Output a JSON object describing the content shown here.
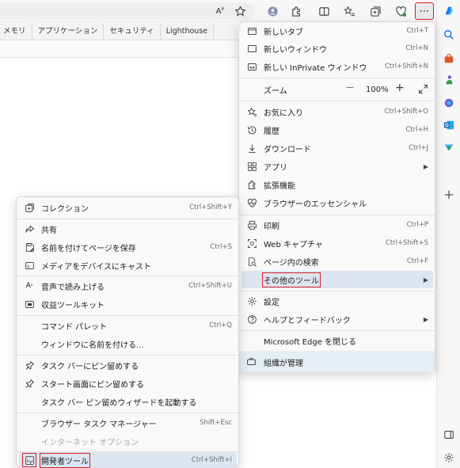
{
  "toolbar": {
    "read_aloud_glyph": "Aᴾ",
    "more_label": "⋯"
  },
  "devtools_tabs": [
    "メモリ",
    "アプリケーション",
    "セキュリティ",
    "Lighthouse"
  ],
  "main_menu": {
    "new_tab": {
      "label": "新しいタブ",
      "shortcut": "Ctrl+T"
    },
    "new_window": {
      "label": "新しいウィンドウ",
      "shortcut": "Ctrl+N"
    },
    "new_inprivate": {
      "label": "新しい InPrivate ウィンドウ",
      "shortcut": "Ctrl+Shift+N"
    },
    "zoom": {
      "label": "ズーム",
      "minus": "—",
      "value": "100%",
      "plus": "+"
    },
    "favorites": {
      "label": "お気に入り",
      "shortcut": "Ctrl+Shift+O"
    },
    "history": {
      "label": "履歴",
      "shortcut": "Ctrl+H"
    },
    "downloads": {
      "label": "ダウンロード",
      "shortcut": "Ctrl+J"
    },
    "apps": {
      "label": "アプリ"
    },
    "extensions": {
      "label": "拡張機能"
    },
    "essentials": {
      "label": "ブラウザーのエッセンシャル"
    },
    "print": {
      "label": "印刷",
      "shortcut": "Ctrl+P"
    },
    "web_capture": {
      "label": "Web キャプチャ",
      "shortcut": "Ctrl+Shift+S"
    },
    "find": {
      "label": "ページ内の検索",
      "shortcut": "Ctrl+F"
    },
    "more_tools": {
      "label": "その他のツール"
    },
    "settings": {
      "label": "設定"
    },
    "help": {
      "label": "ヘルプとフィードバック"
    },
    "close_edge": {
      "label": "Microsoft Edge を閉じる"
    },
    "managed": {
      "label": "組織が管理"
    }
  },
  "sub_menu": {
    "collections": {
      "label": "コレクション",
      "shortcut": "Ctrl+Shift+Y"
    },
    "share": {
      "label": "共有"
    },
    "save_as": {
      "label": "名前を付けてページを保存",
      "shortcut": "Ctrl+S"
    },
    "cast": {
      "label": "メディアをデバイスにキャスト"
    },
    "read_aloud": {
      "label": "音声で読み上げる",
      "shortcut": "Ctrl+Shift+U"
    },
    "revenue_toolkit": {
      "label": "収益ツールキット"
    },
    "command_palette": {
      "label": "コマンド パレット",
      "shortcut": "Ctrl+Q"
    },
    "name_window": {
      "label": "ウィンドウに名前を付ける..."
    },
    "pin_taskbar": {
      "label": "タスク バーにピン留めする"
    },
    "pin_start": {
      "label": "スタート画面にピン留めする"
    },
    "pin_wizard": {
      "label": "タスク バー ピン留めウィザードを起動する"
    },
    "task_manager": {
      "label": "ブラウザー タスク マネージャー",
      "shortcut": "Shift+Esc"
    },
    "internet_options": {
      "label": "インターネット オプション"
    },
    "dev_tools": {
      "label": "開発者ツール",
      "shortcut": "Ctrl+Shift+I"
    }
  },
  "colors": {
    "highlight_red": "#d81f26",
    "hover_blue": "#dce6f0",
    "accent": "#0f6cbd"
  }
}
